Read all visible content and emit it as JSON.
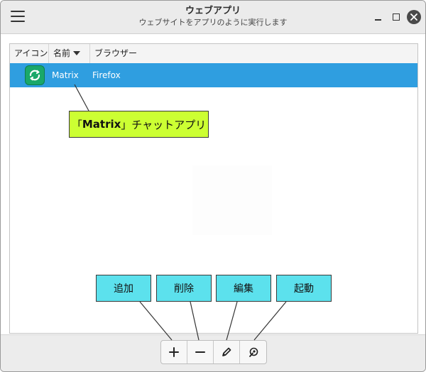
{
  "window": {
    "title": "ウェブアプリ",
    "subtitle": "ウェブサイトをアプリのように実行します"
  },
  "columns": {
    "icon": "アイコン",
    "name": "名前",
    "browser": "ブラウザー"
  },
  "rows": [
    {
      "icon": "matrix-app-icon",
      "name": "Matrix",
      "browser": "Firefox",
      "selected": true
    }
  ],
  "callouts": {
    "matrix_open": "「",
    "matrix_bold": "Matrix",
    "matrix_rest": "」チャットアプリ",
    "add": "追加",
    "delete": "削除",
    "edit": "編集",
    "launch": "起動"
  },
  "toolbar": {
    "add_icon": "plus-icon",
    "remove_icon": "minus-icon",
    "edit_icon": "pencil-icon",
    "launch_icon": "launch-icon"
  },
  "colors": {
    "selection": "#2f9ee0",
    "callout_green": "#ccff33",
    "callout_cyan": "#5ce1ed",
    "matrix_icon": "#1aa86a"
  }
}
